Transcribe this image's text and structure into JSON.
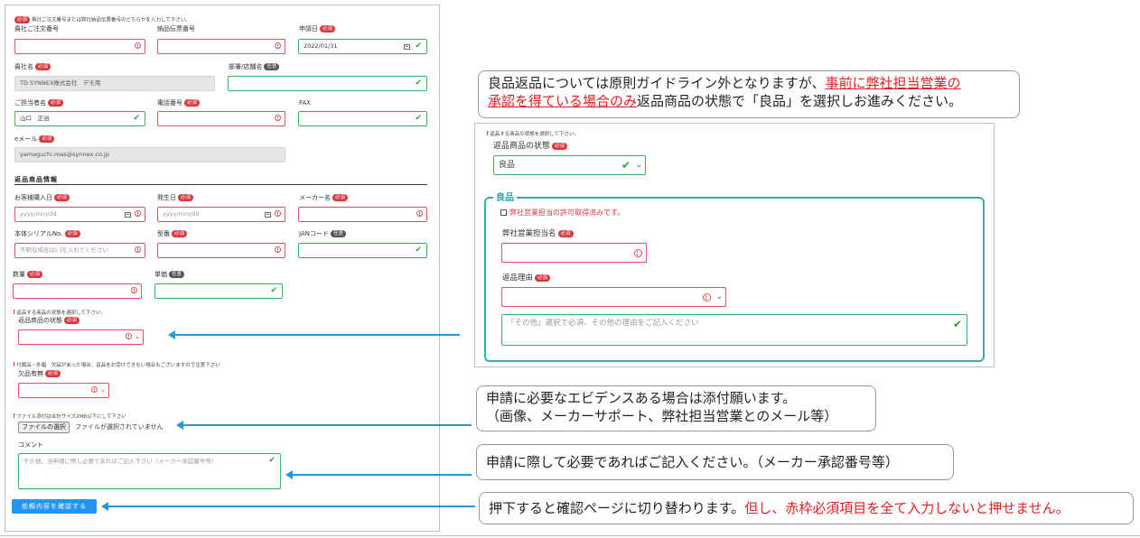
{
  "form": {
    "intro": "貴社ご注文番号または弊社納品伝票番号のどちらかを入力して下さい。",
    "req_badge": "必須",
    "opt_badge": "任意",
    "order_no_label": "貴社ご注文番号",
    "delivery_no_label": "納品伝票番号",
    "apply_date_label": "申請日",
    "apply_date_value": "2022/01/31",
    "company_label": "貴社名",
    "company_value": "TD SYNNEX株式会社　デモ用",
    "dept_label": "部署/店舗名",
    "person_label": "ご担当者名",
    "person_value": "山口　正治",
    "phone_label": "電話番号",
    "fax_label": "FAX",
    "email_label": "eメール",
    "email_value": "yamaguchi.mas@synnex.co.jp",
    "section_title": "返品商品情報",
    "purchase_date_label": "お客様購入日",
    "date_placeholder": "yyyy/mm/dd",
    "occur_date_label": "発生日",
    "maker_label": "メーカー名",
    "serial_label": "本体シリアルNo.",
    "serial_placeholder": "不明な場合は[-]を入れてください",
    "model_label": "型番",
    "jan_label": "JANコード",
    "qty_label": "数量",
    "price_label": "単価",
    "state_note": "返品する商品の状態を選択して下さい。",
    "state_label": "返品商品の状態",
    "missing_note": "付属品・外箱　欠品があった場合、返品をお受けできない場合もございますので注意下さい",
    "missing_label": "欠品有無",
    "file_note": "ファイル添付は合計サイズ2MB以下にして下さい",
    "file_button": "ファイルの選択",
    "file_status": "ファイルが選択されていません",
    "comment_label": "コメント",
    "comment_placeholder": "その他、当申請に際し必要であればご記入下さい（メーカー承認番号等）",
    "submit_label": "依頼内容を確認する"
  },
  "panel": {
    "state_note": "返品する商品の状態を選択して下さい。",
    "state_label": "返品商品の状態",
    "state_value": "良品",
    "group_title": "良品",
    "permission_check": "弊社営業担当の許可取得済みです。",
    "sales_rep_label": "弊社営業担当名",
    "reason_label": "返品理由",
    "other_placeholder": "「その他」選択で必須、その他の理由をご記入ください"
  },
  "callouts": {
    "c1_a": "良品返品については原則ガイドライン外となりますが、",
    "c1_b": "事前に弊社担当営業の",
    "c1_c": "承認を得ている場合のみ",
    "c1_d": "返品商品の状態で「良品」を選択しお進みください。",
    "c2_line1": "申請に必要なエビデンスある場合は添付願います。",
    "c2_line2": "（画像、メーカーサポート、弊社担当営業とのメール等）",
    "c3": "申請に際して必要であればご記入ください。（メーカー承認番号等）",
    "c4_a": "押下すると確認ページに切り替わります。",
    "c4_b": "但し、赤枠必須項目を全て入力しないと押せません。"
  },
  "colors": {
    "required": "#d9363e",
    "valid": "#41b35d",
    "accent": "#2196f3",
    "arrow": "#1e9ad6",
    "group_border": "#3aa9ac"
  }
}
